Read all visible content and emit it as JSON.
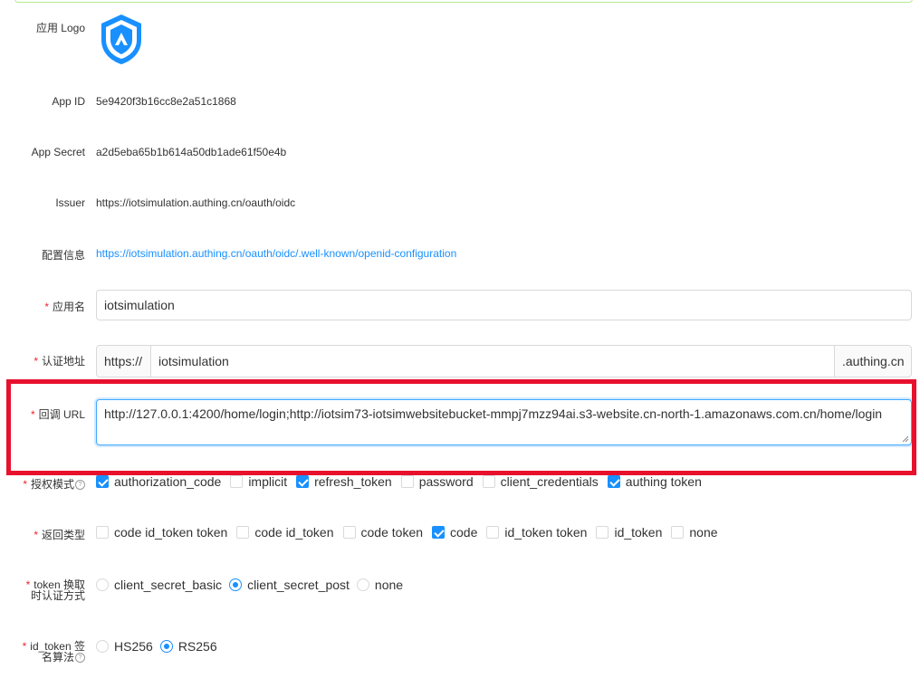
{
  "form": {
    "logo": {
      "label": "应用 Logo",
      "icon": "shield-logo-icon",
      "color": "#1890ff"
    },
    "app_id": {
      "label": "App ID",
      "value": "5e9420f3b16cc8e2a51c1868"
    },
    "app_secret": {
      "label": "App Secret",
      "value": "a2d5eba65b1b614a50db1ade61f50e4b"
    },
    "issuer": {
      "label": "Issuer",
      "value": "https://iotsimulation.authing.cn/oauth/oidc"
    },
    "config_info": {
      "label": "配置信息",
      "value": "https://iotsimulation.authing.cn/oauth/oidc/.well-known/openid-configuration"
    },
    "app_name": {
      "label": "应用名",
      "value": "iotsimulation"
    },
    "auth_domain": {
      "label": "认证地址",
      "prefix": "https://",
      "value": "iotsimulation",
      "suffix": ".authing.cn"
    },
    "callback_url": {
      "label": "回调 URL",
      "value": "http://127.0.0.1:4200/home/login;http://iotsim73-iotsimwebsitebucket-mmpj7mzz94ai.s3-website.cn-north-1.amazonaws.com.cn/home/login"
    },
    "grant_types": {
      "label": "授权模式",
      "options": [
        {
          "label": "authorization_code",
          "checked": true
        },
        {
          "label": "implicit",
          "checked": false
        },
        {
          "label": "refresh_token",
          "checked": true
        },
        {
          "label": "password",
          "checked": false
        },
        {
          "label": "client_credentials",
          "checked": false
        },
        {
          "label": "authing token",
          "checked": true
        }
      ]
    },
    "response_types": {
      "label": "返回类型",
      "options": [
        {
          "label": "code id_token token",
          "checked": false
        },
        {
          "label": "code id_token",
          "checked": false
        },
        {
          "label": "code token",
          "checked": false
        },
        {
          "label": "code",
          "checked": true
        },
        {
          "label": "id_token token",
          "checked": false
        },
        {
          "label": "id_token",
          "checked": false
        },
        {
          "label": "none",
          "checked": false
        }
      ]
    },
    "token_auth_method": {
      "label_line1": "token 换取",
      "label_line2": "时认证方式",
      "options": [
        {
          "label": "client_secret_basic",
          "selected": false
        },
        {
          "label": "client_secret_post",
          "selected": true
        },
        {
          "label": "none",
          "selected": false
        }
      ]
    },
    "id_token_alg": {
      "label_line1": "id_token 签",
      "label_line2": "名算法",
      "options": [
        {
          "label": "HS256",
          "selected": false
        },
        {
          "label": "RS256",
          "selected": true
        }
      ]
    }
  },
  "colors": {
    "accent": "#1890ff",
    "required": "#f5222d",
    "highlight": "#e8112d"
  }
}
